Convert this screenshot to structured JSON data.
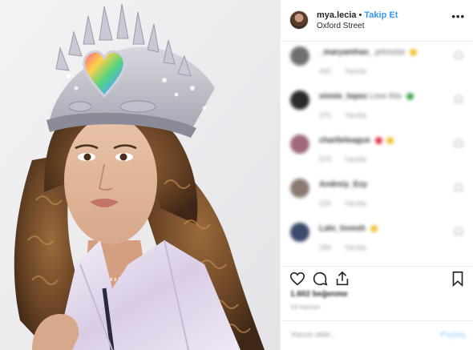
{
  "post": {
    "username": "mya.lecia",
    "separator": "•",
    "follow_label": "Takip Et",
    "location": "Oxford Street",
    "more_label": "•••"
  },
  "comments": [
    {
      "username": "_maryamhao_",
      "text": "princess",
      "likes": "465",
      "reply": "Yanıtla",
      "avatar_color": "#6f6f6f",
      "emoji_color": "#f2c230"
    },
    {
      "username": "vinnie_lopez",
      "text": "Love this",
      "likes": "375",
      "reply": "Yanıtla",
      "avatar_color": "#2a2a2a",
      "emoji_color": "#3aa34a"
    },
    {
      "username": "charlieleague",
      "text": "",
      "likes": "579",
      "reply": "Yanıtla",
      "avatar_color": "#a06a7a",
      "emoji_color": "#e03040"
    },
    {
      "username": "Andreiy_Ezy",
      "text": "",
      "likes": "230",
      "reply": "Yanıtla",
      "avatar_color": "#8a7a72",
      "emoji_color": ""
    },
    {
      "username": "Lalo_lovesh",
      "text": "",
      "likes": "184",
      "reply": "Yanıtla",
      "avatar_color": "#3a4a6a",
      "emoji_color": "#f2c230"
    }
  ],
  "likes_count": "1.602 beğenme",
  "date": "14 haziran",
  "add_comment_placeholder": "Yorum ekle...",
  "post_button": "Paylaş",
  "accent_color": "#3897f0"
}
